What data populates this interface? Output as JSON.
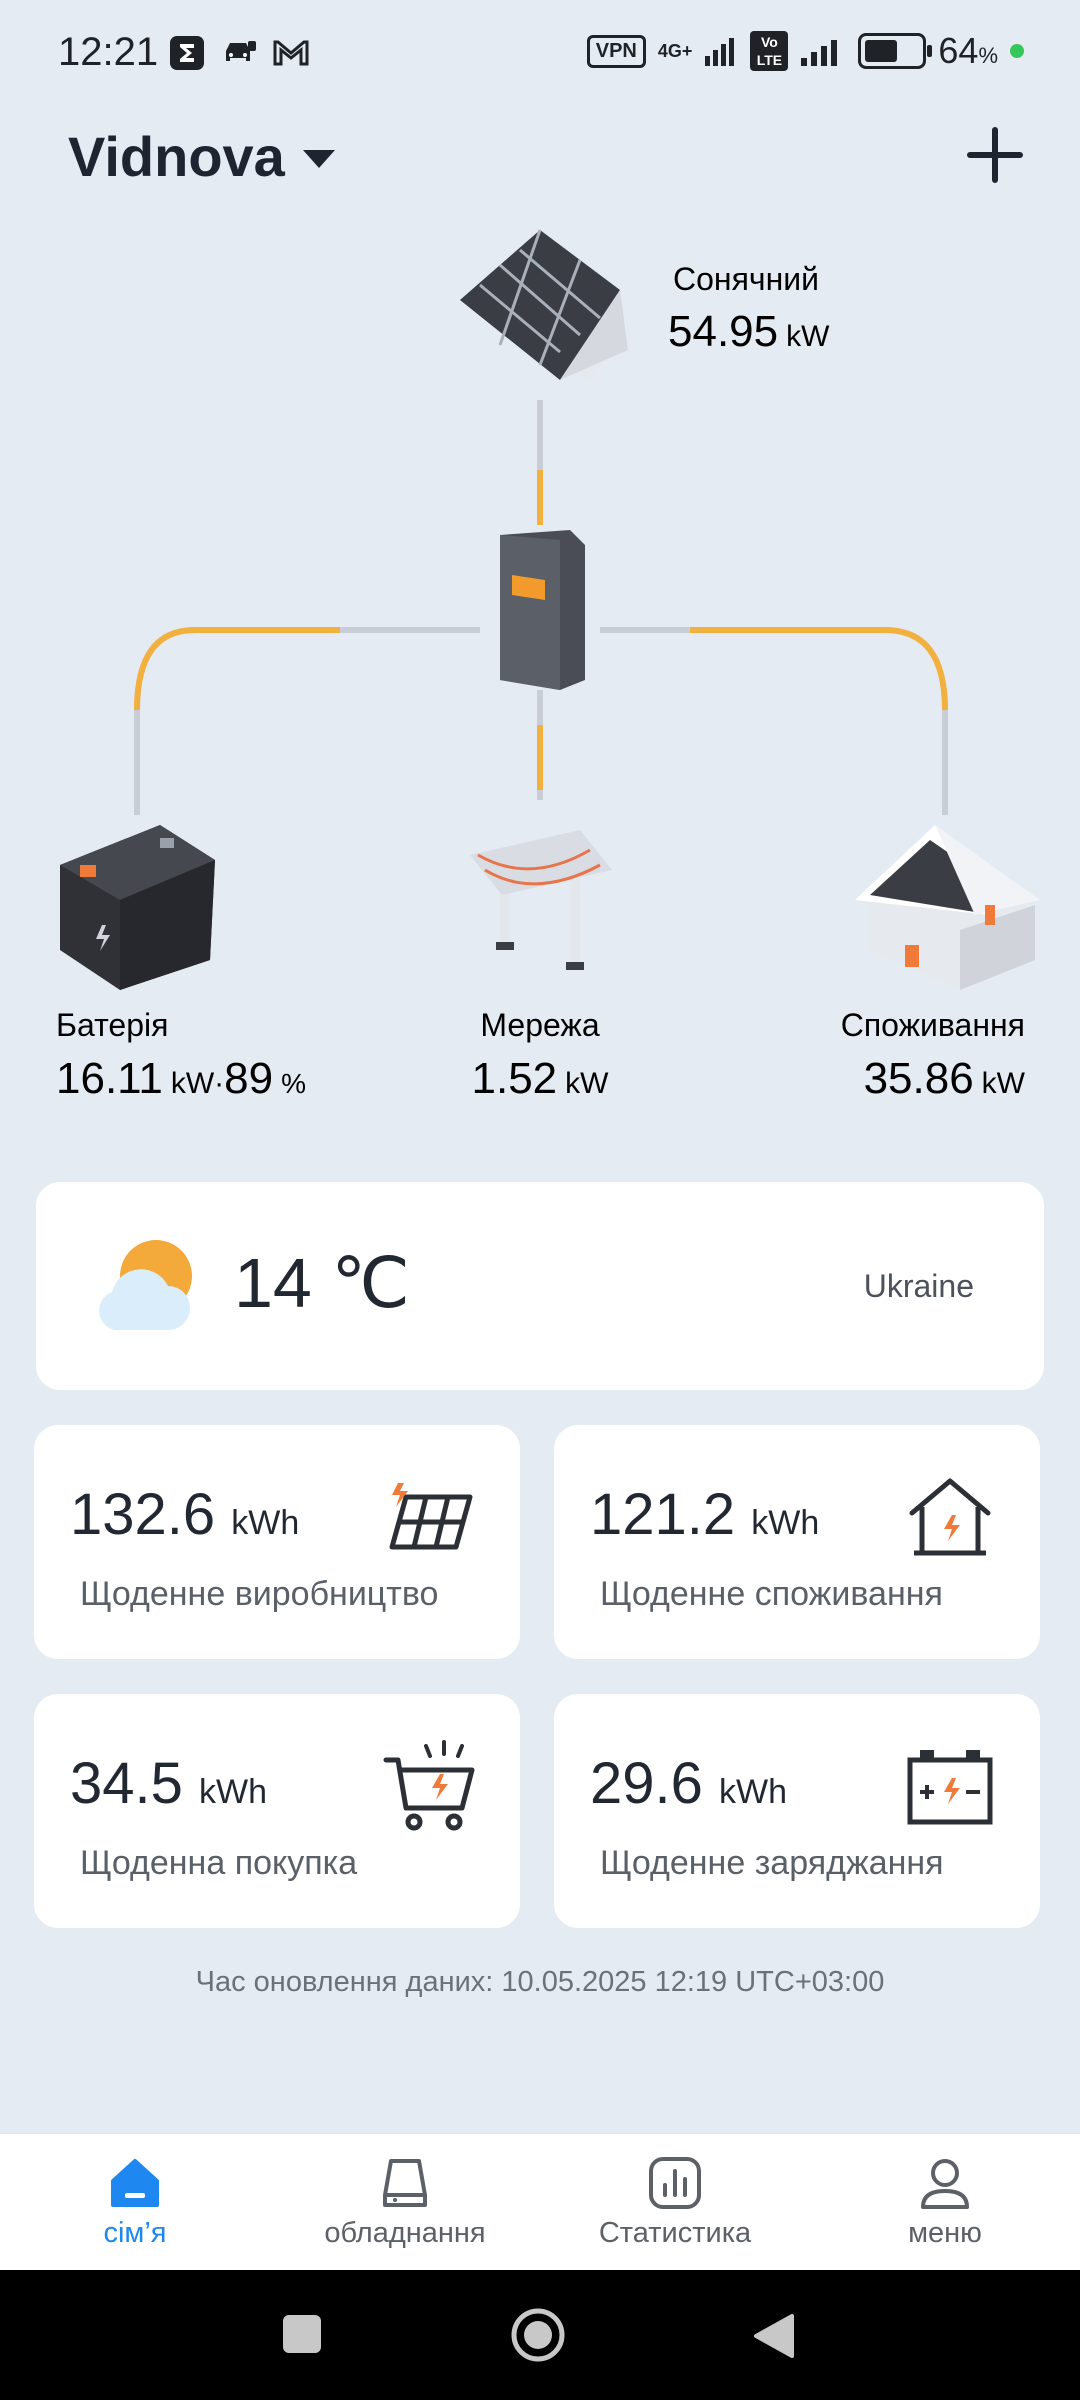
{
  "status_bar": {
    "time": "12:21",
    "vpn": "VPN",
    "network": "4G+",
    "volte": "Vo LTE",
    "battery_percent": "64",
    "battery_percent_symbol": "%",
    "battery_level": 0.64,
    "icons": [
      "sigma-app-icon",
      "car-icon",
      "gmail-icon",
      "signal-icon",
      "signal-icon-2",
      "battery-icon"
    ]
  },
  "header": {
    "site_name": "Vidnova",
    "add_icon": "plus-icon"
  },
  "flow": {
    "solar": {
      "label": "Сонячний",
      "value": "54.95",
      "unit": "kW"
    },
    "battery": {
      "label": "Батерія",
      "value": "16.11",
      "unit": "kW",
      "separator": "·",
      "soc": "89",
      "soc_unit": "%"
    },
    "grid": {
      "label": "Мережа",
      "value": "1.52",
      "unit": "kW"
    },
    "consumption": {
      "label": "Споживання",
      "value": "35.86",
      "unit": "kW"
    },
    "colors": {
      "active_line": "#f2b13f",
      "idle_line": "#c9ced6"
    }
  },
  "weather": {
    "temperature": "14 ℃",
    "location": "Ukraine",
    "icon": "partly-cloudy-icon"
  },
  "stats": [
    {
      "value": "132.6",
      "unit": "kWh",
      "label": "Щоденне виробництво",
      "icon": "solar-panel-icon"
    },
    {
      "value": "121.2",
      "unit": "kWh",
      "label": "Щоденне споживання",
      "icon": "house-icon"
    },
    {
      "value": "34.5",
      "unit": "kWh",
      "label": "Щоденна покупка",
      "icon": "shopping-cart-icon"
    },
    {
      "value": "29.6",
      "unit": "kWh",
      "label": "Щоденне заряджання",
      "icon": "battery-charge-icon"
    }
  ],
  "update_time": "Час оновлення даних: 10.05.2025 12:19 UTC+03:00",
  "bottom_nav": [
    {
      "label": "сім’я",
      "icon": "home-icon",
      "active": true
    },
    {
      "label": "обладнання",
      "icon": "device-icon",
      "active": false
    },
    {
      "label": "Статистика",
      "icon": "chart-icon",
      "active": false
    },
    {
      "label": "меню",
      "icon": "user-icon",
      "active": false
    }
  ],
  "accent_color": "#1e88f0",
  "icon_accent": "#f07a3a"
}
